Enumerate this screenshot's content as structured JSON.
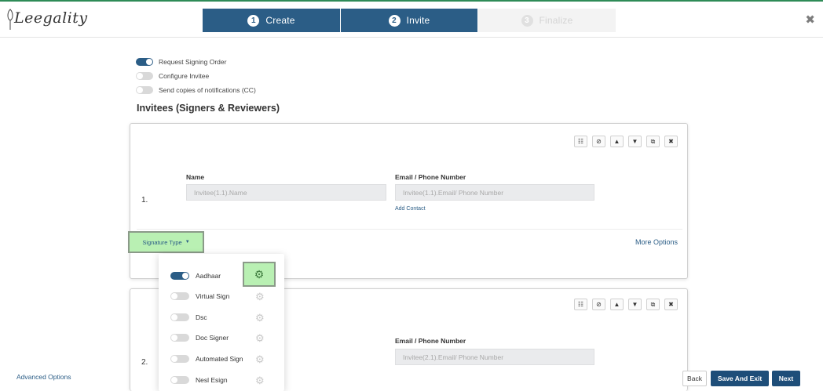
{
  "brand": {
    "logo_text": "Leegality"
  },
  "steps": [
    {
      "number": "1",
      "label": "Create"
    },
    {
      "number": "2",
      "label": "Invite"
    },
    {
      "number": "3",
      "label": "Finalize"
    }
  ],
  "close_icon": "close-icon",
  "settings": {
    "request_signing_order": {
      "label": "Request Signing Order",
      "on": true
    },
    "configure_invitee": {
      "label": "Configure Invitee",
      "on": false
    },
    "send_copies": {
      "label": "Send copies of notifications (CC)",
      "on": false
    }
  },
  "section_title": "Invitees (Signers & Reviewers)",
  "card_tools": [
    "group-icon",
    "check-circle-icon",
    "move-up-icon",
    "move-down-icon",
    "copy-icon",
    "delete-icon"
  ],
  "invitees": [
    {
      "index": "1.",
      "name_label": "Name",
      "name_placeholder": "Invitee(1.1).Name",
      "email_label": "Email / Phone Number",
      "email_placeholder": "Invitee(1.1).Email/ Phone Number",
      "add_contact": "Add Contact",
      "signature_type_label": "Signature Type",
      "more_options": "More Options"
    },
    {
      "index": "2.",
      "email_label": "Email / Phone Number",
      "email_placeholder": "Invitee(2.1).Email/ Phone Number"
    }
  ],
  "signature_types": [
    {
      "label": "Aadhaar",
      "on": true
    },
    {
      "label": "Virtual Sign",
      "on": false
    },
    {
      "label": "Dsc",
      "on": false
    },
    {
      "label": "Doc Signer",
      "on": false
    },
    {
      "label": "Automated Sign",
      "on": false
    },
    {
      "label": "Nesl Esign",
      "on": false
    }
  ],
  "footer": {
    "advanced_options": "Advanced Options",
    "back": "Back",
    "save_and_exit": "Save And Exit",
    "next": "Next"
  },
  "colors": {
    "primary": "#2b5d86",
    "highlight": "#b9f0b3",
    "toggle_off": "#d9d9d9"
  }
}
